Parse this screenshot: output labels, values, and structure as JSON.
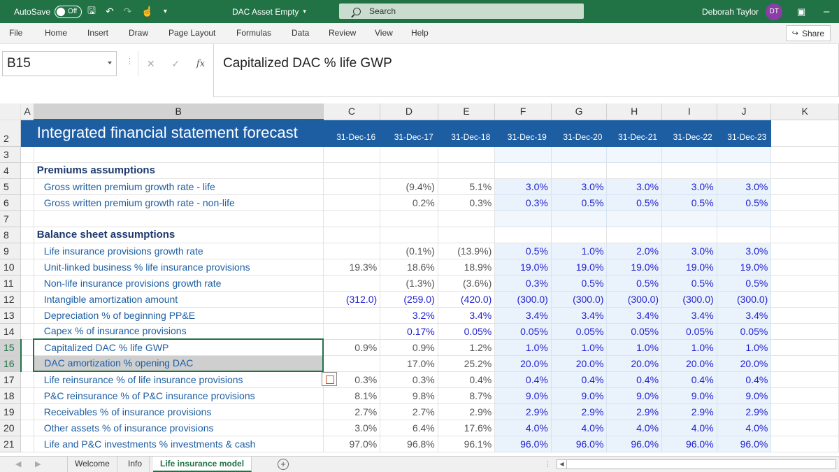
{
  "titlebar": {
    "autosave_label": "AutoSave",
    "autosave_state": "Off",
    "filename": "DAC Asset Empty",
    "search_placeholder": "Search",
    "user_name": "Deborah Taylor",
    "user_initials": "DT"
  },
  "menu": [
    "File",
    "Home",
    "Insert",
    "Draw",
    "Page Layout",
    "Formulas",
    "Data",
    "Review",
    "View",
    "Help"
  ],
  "share_label": "Share",
  "formula_bar": {
    "name_box": "B15",
    "fx": "fx",
    "formula": "Capitalized DAC % life GWP"
  },
  "columns": [
    "A",
    "B",
    "C",
    "D",
    "E",
    "F",
    "G",
    "H",
    "I",
    "J",
    "K"
  ],
  "title_row": {
    "row": "2",
    "title": "Integrated financial statement forecast",
    "dates": [
      "31-Dec-16",
      "31-Dec-17",
      "31-Dec-18",
      "31-Dec-19",
      "31-Dec-20",
      "31-Dec-21",
      "31-Dec-22",
      "31-Dec-23"
    ]
  },
  "rows": [
    {
      "n": "3",
      "type": "empty"
    },
    {
      "n": "4",
      "type": "section",
      "label": "Premiums assumptions"
    },
    {
      "n": "5",
      "label": "Gross written premium growth rate - life",
      "values": [
        "",
        "(9.4%)",
        "5.1%",
        "3.0%",
        "3.0%",
        "3.0%",
        "3.0%",
        "3.0%"
      ]
    },
    {
      "n": "6",
      "label": "Gross written premium growth rate - non-life",
      "values": [
        "",
        "0.2%",
        "0.3%",
        "0.3%",
        "0.5%",
        "0.5%",
        "0.5%",
        "0.5%"
      ]
    },
    {
      "n": "7",
      "type": "empty"
    },
    {
      "n": "8",
      "type": "section",
      "label": "Balance sheet assumptions"
    },
    {
      "n": "9",
      "label": "Life insurance provisions growth rate",
      "values": [
        "",
        "(0.1%)",
        "(13.9%)",
        "0.5%",
        "1.0%",
        "2.0%",
        "3.0%",
        "3.0%"
      ]
    },
    {
      "n": "10",
      "label": "Unit-linked business % life insurance provisions",
      "values": [
        "19.3%",
        "18.6%",
        "18.9%",
        "19.0%",
        "19.0%",
        "19.0%",
        "19.0%",
        "19.0%"
      ]
    },
    {
      "n": "11",
      "label": "Non-life insurance provisions growth rate",
      "values": [
        "",
        "(1.3%)",
        "(3.6%)",
        "0.3%",
        "0.5%",
        "0.5%",
        "0.5%",
        "0.5%"
      ]
    },
    {
      "n": "12",
      "label": "Intangible amortization amount",
      "values": [
        "(312.0)",
        "(259.0)",
        "(420.0)",
        "(300.0)",
        "(300.0)",
        "(300.0)",
        "(300.0)",
        "(300.0)"
      ],
      "blue_hist": true
    },
    {
      "n": "13",
      "label": "Depreciation % of beginning PP&E",
      "values": [
        "",
        "3.2%",
        "3.4%",
        "3.4%",
        "3.4%",
        "3.4%",
        "3.4%",
        "3.4%"
      ],
      "blue_hist": true
    },
    {
      "n": "14",
      "label": "Capex % of insurance provisions",
      "values": [
        "",
        "0.17%",
        "0.05%",
        "0.05%",
        "0.05%",
        "0.05%",
        "0.05%",
        "0.05%"
      ],
      "blue_hist": true
    },
    {
      "n": "15",
      "label": "Capitalized DAC % life GWP",
      "values": [
        "0.9%",
        "0.9%",
        "1.2%",
        "1.0%",
        "1.0%",
        "1.0%",
        "1.0%",
        "1.0%"
      ],
      "selected": true
    },
    {
      "n": "16",
      "label": "DAC amortization % opening DAC",
      "values": [
        "",
        "17.0%",
        "25.2%",
        "20.0%",
        "20.0%",
        "20.0%",
        "20.0%",
        "20.0%"
      ],
      "selected": true
    },
    {
      "n": "17",
      "label": "Life reinsurance % of life insurance provisions",
      "values": [
        "0.3%",
        "0.3%",
        "0.4%",
        "0.4%",
        "0.4%",
        "0.4%",
        "0.4%",
        "0.4%"
      ]
    },
    {
      "n": "18",
      "label": "P&C reinsurance % of P&C insurance provisions",
      "values": [
        "8.1%",
        "9.8%",
        "8.7%",
        "9.0%",
        "9.0%",
        "9.0%",
        "9.0%",
        "9.0%"
      ]
    },
    {
      "n": "19",
      "label": "Receivables % of insurance provisions",
      "values": [
        "2.7%",
        "2.7%",
        "2.9%",
        "2.9%",
        "2.9%",
        "2.9%",
        "2.9%",
        "2.9%"
      ]
    },
    {
      "n": "20",
      "label": "Other assets % of insurance provisions",
      "values": [
        "3.0%",
        "6.4%",
        "17.6%",
        "4.0%",
        "4.0%",
        "4.0%",
        "4.0%",
        "4.0%"
      ]
    },
    {
      "n": "21",
      "label": "Life and P&C investments % investments & cash",
      "values": [
        "97.0%",
        "96.8%",
        "96.1%",
        "96.0%",
        "96.0%",
        "96.0%",
        "96.0%",
        "96.0%"
      ]
    }
  ],
  "sheet_tabs": [
    "Welcome",
    "Info",
    "Life insurance model"
  ],
  "active_tab": "Life insurance model",
  "colors": {
    "excel_green": "#217346",
    "header_blue": "#1d5ea3",
    "input_blue": "#1f1fd1"
  }
}
